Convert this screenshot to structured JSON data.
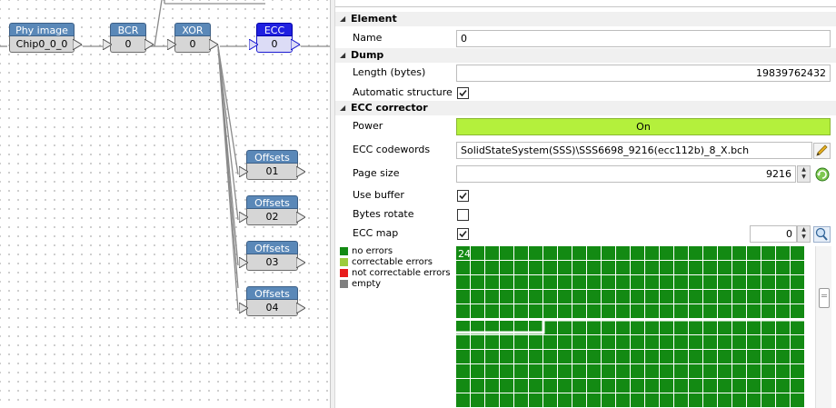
{
  "diagram": {
    "nodes": [
      {
        "id": "phy",
        "title": "Phy image",
        "value": "Chip0_0_0"
      },
      {
        "id": "bcr",
        "title": "BCR",
        "value": "0"
      },
      {
        "id": "xor",
        "title": "XOR",
        "value": "0"
      },
      {
        "id": "ecc",
        "title": "ECC",
        "value": "0",
        "selected": true
      },
      {
        "id": "off1",
        "title": "Offsets",
        "value": "01"
      },
      {
        "id": "off2",
        "title": "Offsets",
        "value": "02"
      },
      {
        "id": "off3",
        "title": "Offsets",
        "value": "03"
      },
      {
        "id": "off4",
        "title": "Offsets",
        "value": "04"
      }
    ]
  },
  "properties": {
    "element": {
      "label": "Element",
      "name_label": "Name",
      "name_value": "0"
    },
    "dump": {
      "label": "Dump",
      "length_label": "Length (bytes)",
      "length_value": "19839762432",
      "auto_label": "Automatic structure",
      "auto_checked": true
    },
    "ecc": {
      "label": "ECC corrector",
      "power_label": "Power",
      "power_value": "On",
      "power_color": "#b4f03c",
      "codewords_label": "ECC codewords",
      "codewords_value": "SolidStateSystem(SSS)\\SSS6698_9216(ecc112b)_8_X.bch",
      "page_label": "Page size",
      "page_value": "9216",
      "buffer_label": "Use buffer",
      "buffer_checked": true,
      "rotate_label": "Bytes rotate",
      "rotate_checked": false,
      "map_label": "ECC map",
      "map_checked": true,
      "map_value": "0"
    },
    "legend": [
      {
        "label": "no errors",
        "color": "#138a13"
      },
      {
        "label": "correctable errors",
        "color": "#9ccc3c"
      },
      {
        "label": "not correctable errors",
        "color": "#e81c1c"
      },
      {
        "label": "empty",
        "color": "#7f7f7f"
      }
    ],
    "map": {
      "label": "24",
      "cell_color": "#138a13"
    }
  },
  "icons": [
    "edit-icon",
    "refresh-icon",
    "zoom-icon",
    "spin-up-icon",
    "spin-down-icon",
    "collapse-triangle-icon"
  ]
}
